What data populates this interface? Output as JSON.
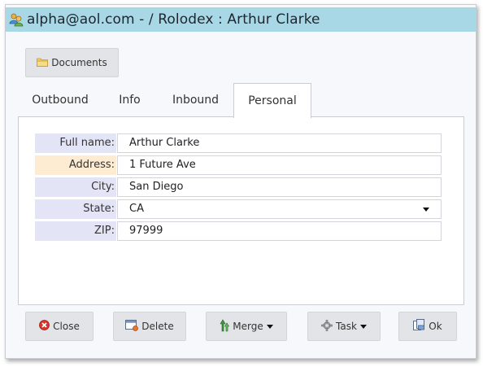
{
  "window": {
    "title": "alpha@aol.com - / Rolodex : Arthur Clarke",
    "icon": "users-icon"
  },
  "toolbar": {
    "documents_label": "Documents",
    "documents_icon": "folder-icon"
  },
  "tabs": [
    {
      "label": "Outbound",
      "active": false
    },
    {
      "label": "Info",
      "active": false
    },
    {
      "label": "Inbound",
      "active": false
    },
    {
      "label": "Personal",
      "active": true
    }
  ],
  "form": {
    "full_name": {
      "label": "Full name:",
      "value": "Arthur Clarke"
    },
    "address": {
      "label": "Address:",
      "value": "1 Future Ave",
      "highlighted": true
    },
    "city": {
      "label": "City:",
      "value": "San Diego"
    },
    "state": {
      "label": "State:",
      "value": "CA"
    },
    "zip": {
      "label": "ZIP:",
      "value": "97999"
    }
  },
  "footer": {
    "close_label": "Close",
    "delete_label": "Delete",
    "merge_label": "Merge",
    "task_label": "Task",
    "ok_label": "Ok"
  },
  "colors": {
    "titlebar": "#a8d8e6",
    "label_bg": "#e3e4f6",
    "label_highlight": "#fdebd2",
    "close_red": "#d9342b",
    "merge_green": "#3c9a3c"
  }
}
